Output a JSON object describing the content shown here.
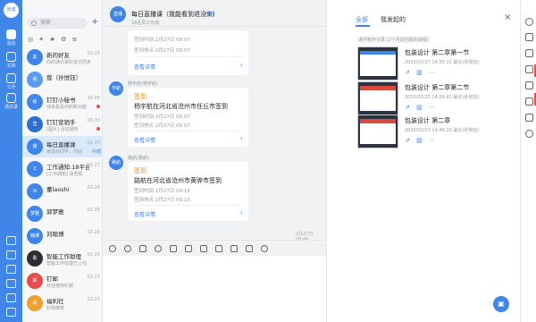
{
  "sidebar": {
    "avatar": "张成",
    "items": [
      {
        "label": "消息",
        "icon": "chat-icon"
      },
      {
        "label": "文档",
        "icon": "doc-icon"
      },
      {
        "label": "工作",
        "icon": "work-icon"
      },
      {
        "label": "通讯录",
        "icon": "contacts-icon"
      }
    ]
  },
  "convlist": {
    "search_placeholder": "搜索",
    "filters": [
      "◎",
      "✦",
      "★",
      "⚙",
      "≡"
    ],
    "items": [
      {
        "name": "新的好友",
        "msg": "你的通讯录好友已同步",
        "time": "02-25",
        "avatar": "友",
        "color": "#3f86e8"
      },
      {
        "name": "我（孙悦钰）",
        "msg": "",
        "time": "",
        "avatar": "我",
        "color": "#5b9bf0"
      },
      {
        "name": "钉钉小秘书",
        "msg": "快来看看你的新功能",
        "time": "15:08",
        "avatar": "秘",
        "color": "#3f86e8",
        "dot": true
      },
      {
        "name": "钉钉营销手",
        "msg": "[图片] 活动通知",
        "time": "09:30",
        "avatar": "营",
        "color": "#2b6fd1",
        "dot": true
      },
      {
        "name": "每日直播课",
        "msg": "亲爱的同学，你好",
        "time": "02-27",
        "avatar": "播",
        "color": "#3f86e8",
        "tag": "内部"
      },
      {
        "name": "工作通知:18平台",
        "msg": "[工作通知] 请查看",
        "time": "02-27",
        "avatar": "工",
        "color": "#3f86e8"
      },
      {
        "name": "董laoshi",
        "msg": "",
        "time": "02-26",
        "avatar": "N",
        "color": "#3f86e8"
      },
      {
        "name": "郭梦雅",
        "msg": "",
        "time": "02-26",
        "avatar": "梦雅",
        "color": "#3f86e8"
      },
      {
        "name": "刘翰博",
        "msg": "",
        "time": "02-26",
        "avatar": "翰博",
        "color": "#3f86e8"
      },
      {
        "name": "智能工作助理",
        "msg": "智能工作助理已上线",
        "time": "02-25",
        "avatar": "助",
        "color": "#2e2e2e"
      },
      {
        "name": "钉邮",
        "msg": "欢迎使用钉邮",
        "time": "02-25",
        "avatar": "邮",
        "color": "#e84c4c"
      },
      {
        "name": "福利社",
        "msg": "好物推荐",
        "time": "02-25",
        "avatar": "福",
        "color": "#f0a030"
      }
    ]
  },
  "chat": {
    "avatar": "直播",
    "title": "每日直播课（我能看到退没来）",
    "tag": "内部",
    "subtitle": "16名员工在线",
    "card1": {
      "sign": "签到时间 2月27日 09:07",
      "loc": "签到地点 2月27日 09:07",
      "link": "查看详情"
    },
    "msg2": {
      "avatar": "宇航",
      "sender": "杨宇航(杨宇航)",
      "type": "签到",
      "body": "杨宇航在河北省沧州市任丘市签到",
      "time": "签到时间 2月27日 09:07",
      "loc": "签到地点 2月27日 09:07",
      "link": "查看详情"
    },
    "msg3": {
      "avatar": "路航",
      "sender": "路航(路航)",
      "type": "签到",
      "body": "路航在河北省沧州市黄骅市签到",
      "time": "签到时间 2月27日 09:15",
      "loc": "签到地点 2月27日 09:15",
      "link": "查看详情"
    },
    "timestamp": "2月27日 09:46"
  },
  "panel": {
    "tabs": [
      "全部",
      "我发起的"
    ],
    "hint": "课件制作记录 (2个月前创建的课程)",
    "items": [
      {
        "title": "包装设计 第二章第一节",
        "meta": "2020/02/27 14:55:31 最长(孙悦钰)"
      },
      {
        "title": "包装设计 第二章第二节",
        "meta": "2020/02/25 14:58:41 最长(孙悦钰)"
      },
      {
        "title": "包装设计 第二章",
        "meta": "2020/02/23 14:48:20 最长(孙悦钰)"
      }
    ],
    "actions": [
      "分享",
      "数据",
      "更多"
    ]
  }
}
